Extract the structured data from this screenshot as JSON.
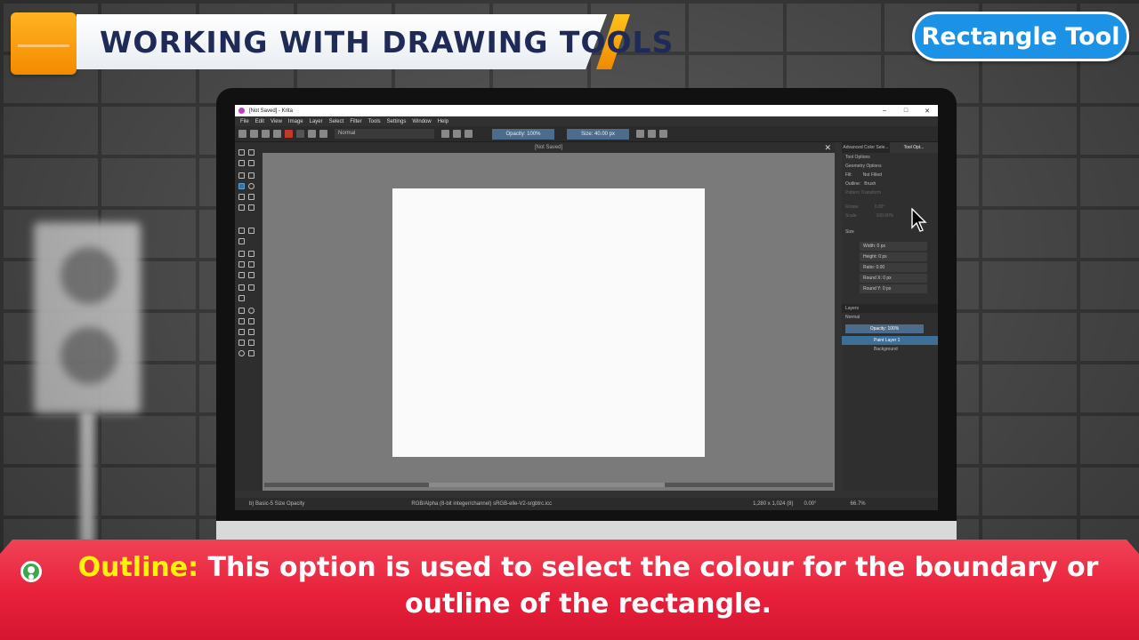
{
  "title_banner": {
    "text": "WORKING WITH DRAWING TOOLS"
  },
  "tool_badge": {
    "text": "Rectangle Tool"
  },
  "caption": {
    "keyword": "Outline:",
    "text": "This option is used to select the colour for the boundary or outline of the rectangle."
  },
  "krita": {
    "window_title": "[Not Saved] - Krita",
    "menu": [
      "File",
      "Edit",
      "View",
      "Image",
      "Layer",
      "Select",
      "Filter",
      "Tools",
      "Settings",
      "Window",
      "Help"
    ],
    "toolbar": {
      "blend_mode": "Normal",
      "opacity": "Opacity: 100%",
      "size": "Size: 40.00 px"
    },
    "canvas_tab": "[Not Saved]",
    "dock_tabs": [
      "Advanced Color Sele...",
      "Tool Opt..."
    ],
    "tool_options": {
      "header": "Tool Options",
      "geometry": "Geometry Options",
      "fill_label": "Fill:",
      "fill_value": "Not Filled",
      "outline_label": "Outline:",
      "outline_value": "Brush",
      "pattern_transform": "Pattern Transform",
      "rotate_label": "Rotate",
      "rotate_value": "0.00°",
      "scale_label": "Scale",
      "scale_value": "100.00%",
      "size_header": "Size",
      "width": "Width: 0 px",
      "height": "Height: 0 px",
      "ratio": "Ratio: 0.00",
      "round_x": "Round X: 0 px",
      "round_y": "Round Y: 0 px"
    },
    "layers": {
      "header": "Layers",
      "blend_mode": "Normal",
      "opacity": "Opacity: 100%",
      "items": [
        "Paint Layer 1",
        "Background"
      ]
    },
    "status": {
      "brush": "b) Basic-5 Size Opacity",
      "color_space": "RGB/Alpha (8-bit integer/channel)  sRGB-elle-V2-srgbtrc.icc",
      "dimensions": "1,280 x 1,024 (8)",
      "rotation": "0.00°",
      "zoom": "66.7%"
    }
  }
}
